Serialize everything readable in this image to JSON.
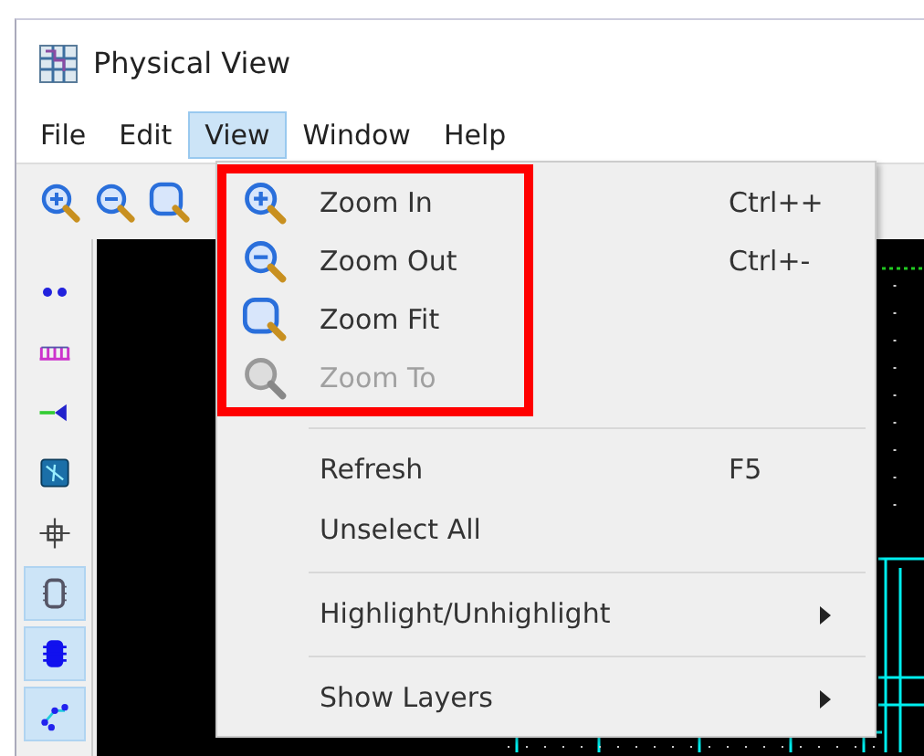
{
  "window": {
    "title": "Physical View"
  },
  "menu_bar": [
    {
      "label": "File",
      "selected": false
    },
    {
      "label": "Edit",
      "selected": false
    },
    {
      "label": "View",
      "selected": true
    },
    {
      "label": "Window",
      "selected": false
    },
    {
      "label": "Help",
      "selected": false
    }
  ],
  "side_tools": [
    {
      "selected": false
    },
    {
      "selected": false
    },
    {
      "selected": false
    },
    {
      "selected": false
    },
    {
      "selected": false
    },
    {
      "selected": true
    },
    {
      "selected": true
    },
    {
      "selected": true
    }
  ],
  "view_menu": [
    {
      "kind": "item",
      "label": "Zoom In",
      "shortcut": "Ctrl++",
      "disabled": false,
      "callout": true
    },
    {
      "kind": "item",
      "label": "Zoom Out",
      "shortcut": "Ctrl+-",
      "disabled": false,
      "callout": true
    },
    {
      "kind": "item",
      "label": "Zoom Fit",
      "disabled": false,
      "callout": true
    },
    {
      "kind": "item",
      "label": "Zoom To",
      "disabled": true,
      "callout": true
    },
    {
      "kind": "separator"
    },
    {
      "kind": "item",
      "label": "Refresh",
      "shortcut": "F5",
      "disabled": false,
      "callout": false
    },
    {
      "kind": "item",
      "label": "Unselect All",
      "disabled": false,
      "callout": false
    },
    {
      "kind": "separator"
    },
    {
      "kind": "submenu",
      "label": "Highlight/Unhighlight",
      "disabled": false,
      "callout": false
    },
    {
      "kind": "separator"
    },
    {
      "kind": "submenu",
      "label": "Show Layers",
      "disabled": false,
      "callout": false
    }
  ]
}
